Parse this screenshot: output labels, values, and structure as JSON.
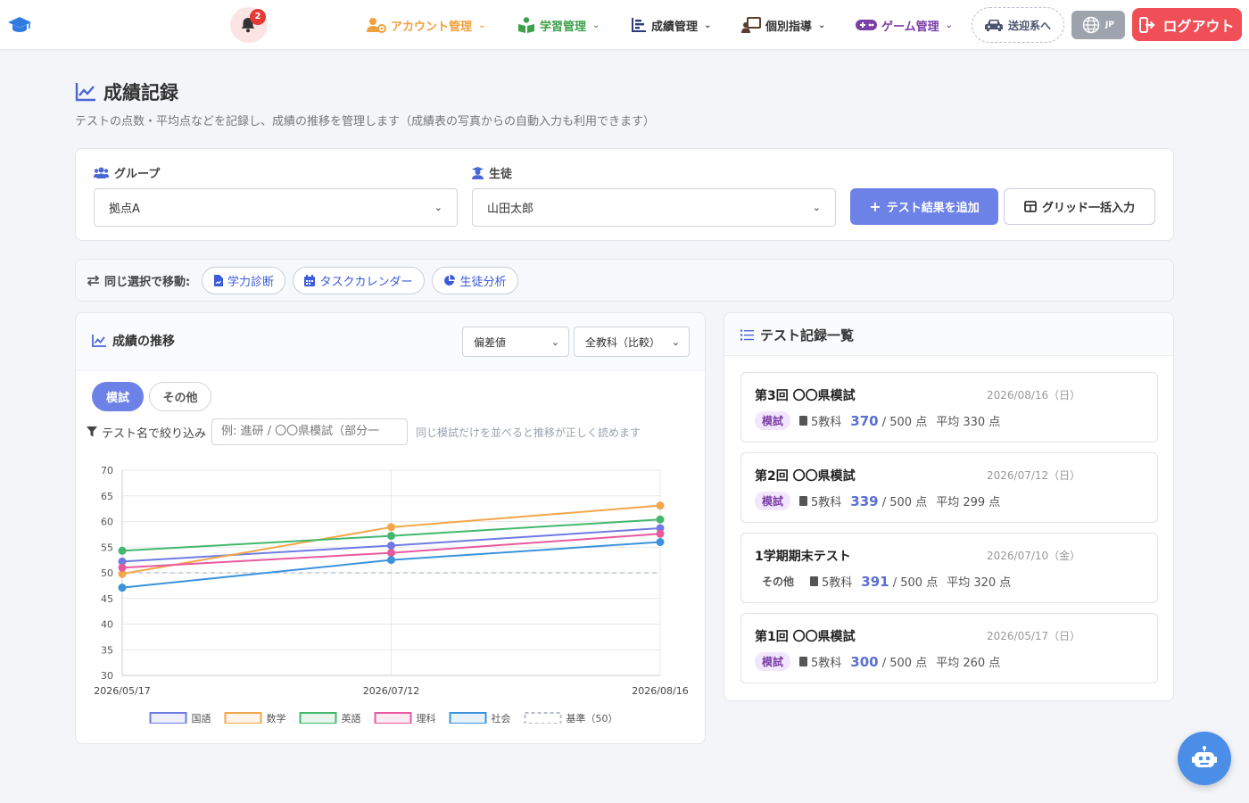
{
  "header": {
    "notification_count": "2",
    "nav": [
      {
        "label": "アカウント管理",
        "icon": "users-cog-icon",
        "color": "#f0a03c"
      },
      {
        "label": "学習管理",
        "icon": "book-reader-icon",
        "color": "#3ca14a"
      },
      {
        "label": "成績管理",
        "icon": "chart-bars-icon",
        "color": "#2e3a7a"
      },
      {
        "label": "個別指導",
        "icon": "teacher-board-icon",
        "color": "#5a3e2b"
      },
      {
        "label": "ゲーム管理",
        "icon": "gamepad-icon",
        "color": "#7b3fa8"
      }
    ],
    "pickup_label": "送迎系へ",
    "lang_label": "JP",
    "logout_label": "ログアウト"
  },
  "page": {
    "title": "成績記録",
    "subtitle": "テストの点数・平均点などを記録し、成績の推移を管理します（成績表の写真からの自動入力も利用できます）"
  },
  "filters": {
    "group_label": "グループ",
    "group_value": "拠点A",
    "student_label": "生徒",
    "student_value": "山田太郎",
    "add_button": "テスト結果を追加",
    "grid_button": "グリッド一括入力"
  },
  "move_bar": {
    "label": "同じ選択で移動:",
    "links": [
      "学力診断",
      "タスクカレンダー",
      "生徒分析"
    ]
  },
  "chart_panel": {
    "title": "成績の推移",
    "metric_select": "偏差値",
    "subject_select": "全教科（比較）",
    "tab_active": "模試",
    "tab_inactive": "その他",
    "filter_label": "テスト名で絞り込み",
    "filter_placeholder": "例: 進研 / 〇〇県模試（部分一",
    "filter_hint": "同じ模試だけを並べると推移が正しく読めます"
  },
  "chart_data": {
    "type": "line",
    "x": [
      "2026/05/17",
      "2026/07/12",
      "2026/08/16"
    ],
    "ylim": [
      30,
      70
    ],
    "yticks": [
      30,
      35,
      40,
      45,
      50,
      55,
      60,
      65,
      70
    ],
    "grid": true,
    "legend_position": "bottom",
    "series": [
      {
        "name": "国語",
        "values": [
          52.2,
          55.3,
          58.7
        ],
        "color": "#6f7be3"
      },
      {
        "name": "数学",
        "values": [
          49.8,
          58.9,
          63.1
        ],
        "color": "#f3a64a"
      },
      {
        "name": "英語",
        "values": [
          54.3,
          57.2,
          60.4
        ],
        "color": "#43b86c"
      },
      {
        "name": "理科",
        "values": [
          51.0,
          53.9,
          57.6
        ],
        "color": "#e85a9e"
      },
      {
        "name": "社会",
        "values": [
          47.1,
          52.5,
          56.0
        ],
        "color": "#3b93dc"
      }
    ],
    "baseline": {
      "name": "基準（50）",
      "value": 50,
      "color": "#b8bcc8"
    }
  },
  "records_panel": {
    "title": "テスト記録一覧",
    "items": [
      {
        "name": "第3回 〇〇県模試",
        "date": "2026/08/16（日）",
        "type": "模試",
        "subjects": "5教科",
        "score": "370",
        "total": "/ 500 点",
        "avg": "平均 330 点"
      },
      {
        "name": "第2回 〇〇県模試",
        "date": "2026/07/12（日）",
        "type": "模試",
        "subjects": "5教科",
        "score": "339",
        "total": "/ 500 点",
        "avg": "平均 299 点"
      },
      {
        "name": "1学期期末テスト",
        "date": "2026/07/10（金）",
        "type": "その他",
        "subjects": "5教科",
        "score": "391",
        "total": "/ 500 点",
        "avg": "平均 320 点"
      },
      {
        "name": "第1回 〇〇県模試",
        "date": "2026/05/17（日）",
        "type": "模試",
        "subjects": "5教科",
        "score": "300",
        "total": "/ 500 点",
        "avg": "平均 260 点"
      }
    ]
  }
}
